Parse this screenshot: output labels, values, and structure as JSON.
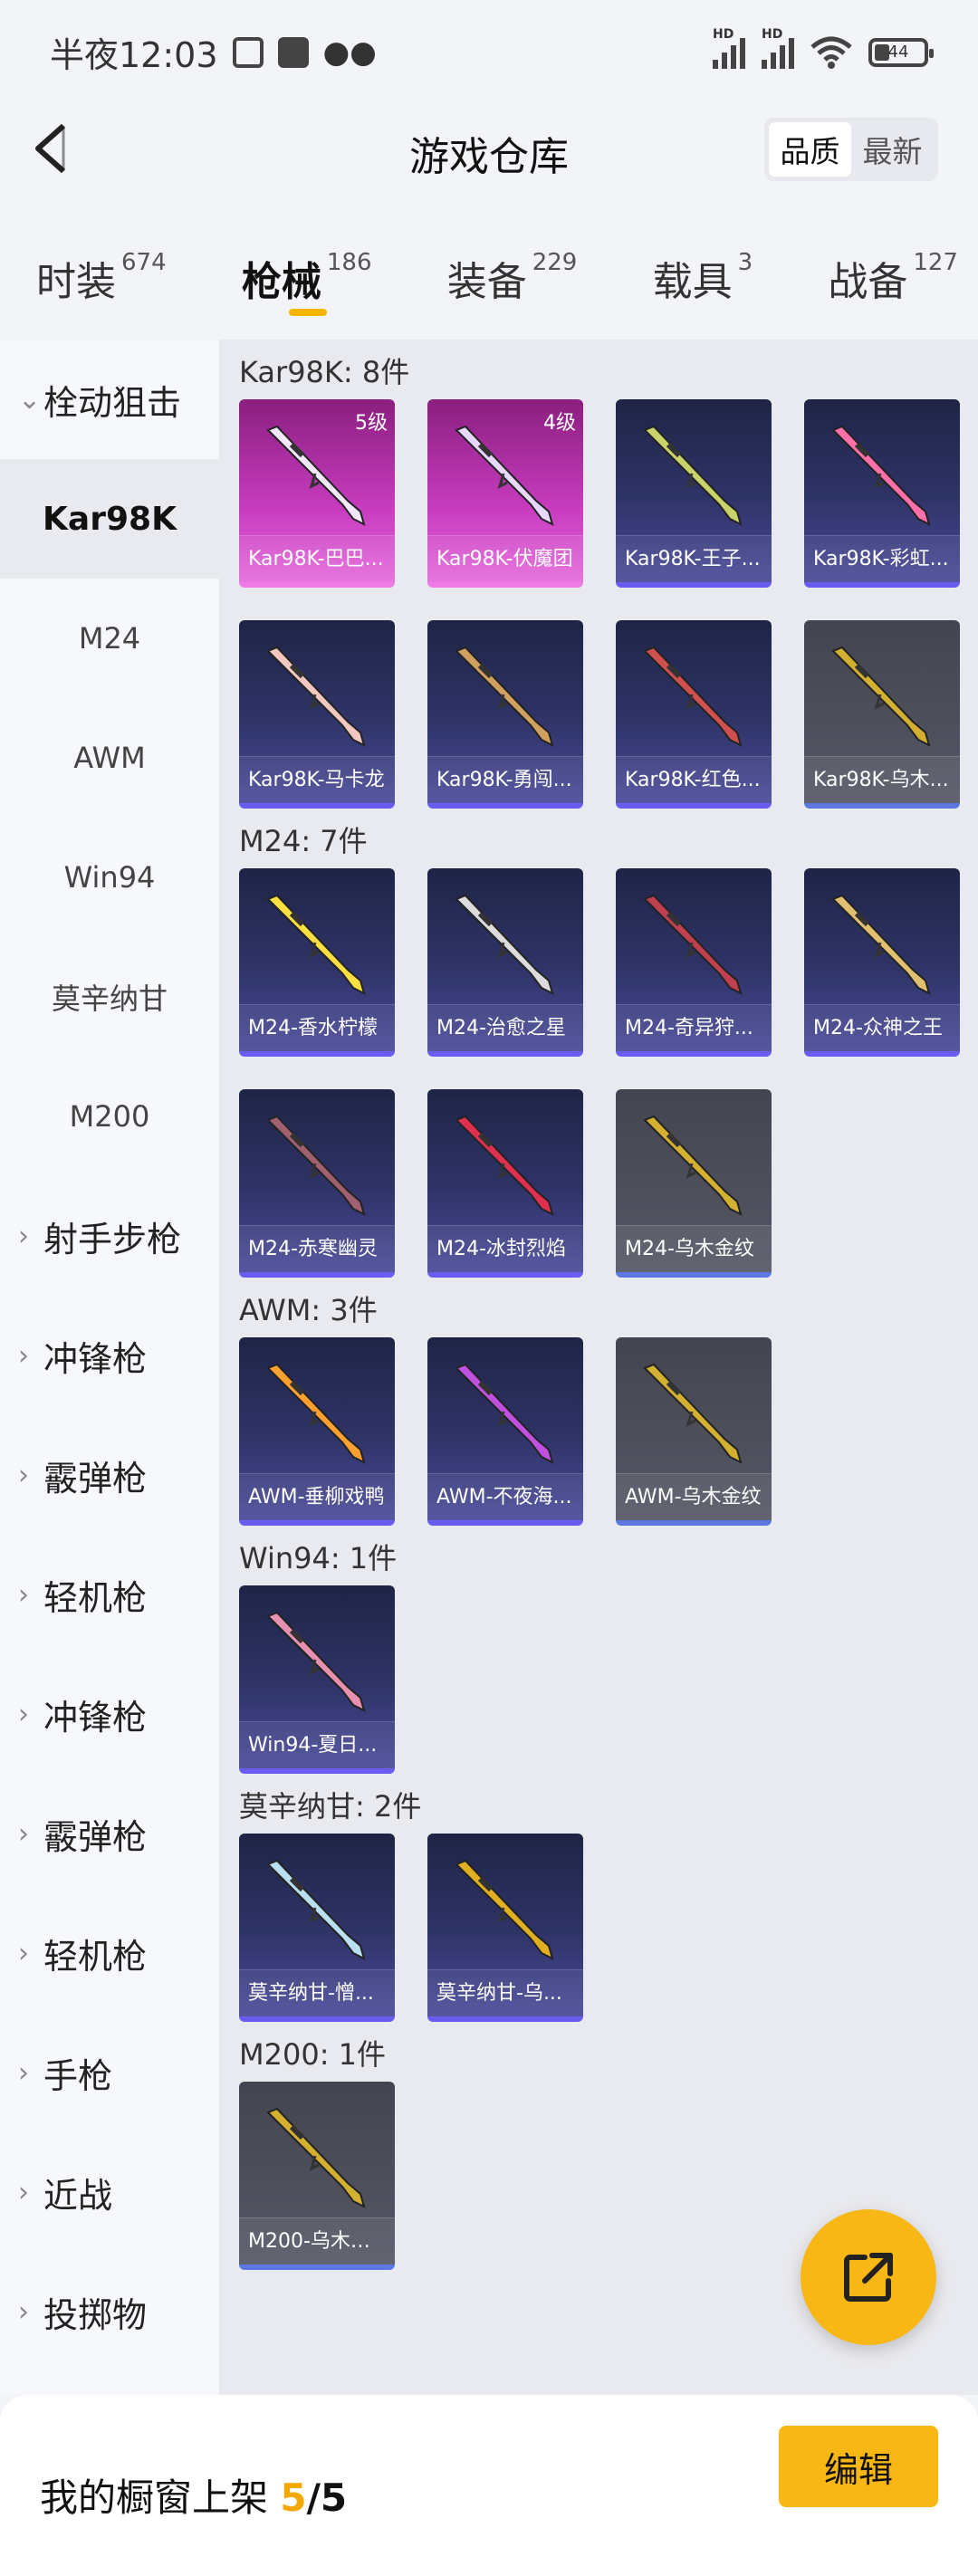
{
  "status_bar": {
    "time": "半夜12:03",
    "battery": "44",
    "net1": "HD",
    "net2": "HD"
  },
  "header": {
    "title": "游戏仓库",
    "sort_options": [
      "品质",
      "最新"
    ],
    "sort_selected": "品质"
  },
  "tabs": [
    {
      "label": "时装",
      "count": "674"
    },
    {
      "label": "枪械",
      "count": "186",
      "active": true
    },
    {
      "label": "装备",
      "count": "229"
    },
    {
      "label": "载具",
      "count": "3"
    },
    {
      "label": "战备",
      "count": "127"
    }
  ],
  "sidebar": [
    {
      "label": "栓动狙击",
      "type": "cat",
      "expanded": true
    },
    {
      "label": "Kar98K",
      "type": "sub",
      "active": true
    },
    {
      "label": "M24",
      "type": "sub"
    },
    {
      "label": "AWM",
      "type": "sub"
    },
    {
      "label": "Win94",
      "type": "sub"
    },
    {
      "label": "莫辛纳甘",
      "type": "sub"
    },
    {
      "label": "M200",
      "type": "sub"
    },
    {
      "label": "射手步枪",
      "type": "cat"
    },
    {
      "label": "冲锋枪",
      "type": "cat"
    },
    {
      "label": "霰弹枪",
      "type": "cat"
    },
    {
      "label": "轻机枪",
      "type": "cat"
    },
    {
      "label": "冲锋枪",
      "type": "cat"
    },
    {
      "label": "霰弹枪",
      "type": "cat"
    },
    {
      "label": "轻机枪",
      "type": "cat"
    },
    {
      "label": "手枪",
      "type": "cat"
    },
    {
      "label": "近战",
      "type": "cat"
    },
    {
      "label": "投掷物",
      "type": "cat"
    }
  ],
  "groups": [
    {
      "title": "Kar98K: 8件",
      "items": [
        {
          "name": "Kar98K-巴巴...",
          "level": "5级",
          "style": "pink",
          "color": "#f3e8ff"
        },
        {
          "name": "Kar98K-伏魔团",
          "level": "4级",
          "style": "pink",
          "color": "#e8d8ff"
        },
        {
          "name": "Kar98K-王子...",
          "style": "purple",
          "color": "#c9d36a"
        },
        {
          "name": "Kar98K-彩虹...",
          "style": "purple",
          "color": "#ff6fa8"
        },
        {
          "name": "Kar98K-马卡龙",
          "style": "purple",
          "color": "#f2c7c0"
        },
        {
          "name": "Kar98K-勇闯...",
          "style": "purple",
          "color": "#d0a060"
        },
        {
          "name": "Kar98K-红色...",
          "style": "purple",
          "color": "#d05050"
        },
        {
          "name": "Kar98K-乌木...",
          "style": "gold",
          "color": "#d4b030"
        }
      ]
    },
    {
      "title": "M24: 7件",
      "items": [
        {
          "name": "M24-香水柠檬",
          "style": "purple",
          "color": "#ffe040"
        },
        {
          "name": "M24-治愈之星",
          "style": "purple",
          "color": "#dcdcdc"
        },
        {
          "name": "M24-奇异狩...",
          "style": "purple",
          "color": "#c04050"
        },
        {
          "name": "M24-众神之王",
          "style": "purple",
          "color": "#e0c070"
        },
        {
          "name": "M24-赤寒幽灵",
          "style": "purple",
          "color": "#a06070"
        },
        {
          "name": "M24-冰封烈焰",
          "style": "purple",
          "color": "#e03050"
        },
        {
          "name": "M24-乌木金纹",
          "style": "gold",
          "color": "#d4b030"
        }
      ]
    },
    {
      "title": "AWM: 3件",
      "items": [
        {
          "name": "AWM-垂柳戏鸭",
          "style": "purple",
          "color": "#ffa030"
        },
        {
          "name": "AWM-不夜海...",
          "style": "purple",
          "color": "#c050e0"
        },
        {
          "name": "AWM-乌木金纹",
          "style": "gold",
          "color": "#d4b030"
        }
      ]
    },
    {
      "title": "Win94: 1件",
      "items": [
        {
          "name": "Win94-夏日...",
          "style": "purple",
          "color": "#e890b0"
        }
      ]
    },
    {
      "title": "莫辛纳甘: 2件",
      "items": [
        {
          "name": "莫辛纳甘-憎...",
          "style": "purple",
          "color": "#b8e0f0"
        },
        {
          "name": "莫辛纳甘-乌...",
          "style": "purple",
          "color": "#e0b020"
        }
      ]
    },
    {
      "title": "M200: 1件",
      "items": [
        {
          "name": "M200-乌木金...",
          "style": "gold",
          "color": "#d4b030"
        }
      ]
    }
  ],
  "bottom": {
    "label": "我的橱窗上架 ",
    "count": "5",
    "total": "/5",
    "edit": "编辑"
  }
}
